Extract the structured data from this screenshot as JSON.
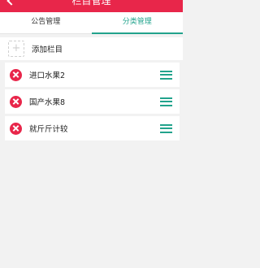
{
  "header": {
    "title": "栏目管理",
    "back_icon": "back-arrow-icon"
  },
  "tabs": [
    {
      "label": "公告管理",
      "active": false
    },
    {
      "label": "分类管理",
      "active": true
    }
  ],
  "add": {
    "icon": "plus-icon",
    "label": "添加栏目"
  },
  "items": [
    {
      "label": "进口水果2"
    },
    {
      "label": "国产水果8"
    },
    {
      "label": "就斤斤计较"
    }
  ],
  "colors": {
    "brand": "#e8264a",
    "accent": "#22a38c"
  }
}
